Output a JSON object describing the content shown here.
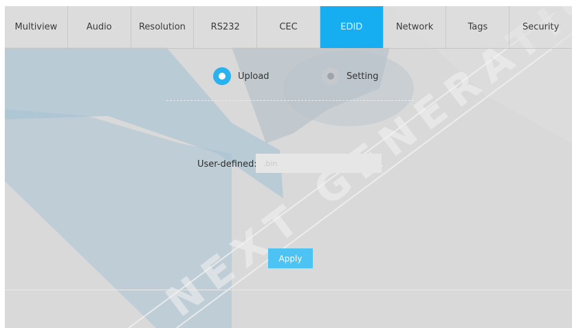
{
  "tabs": [
    {
      "label": "Multiview",
      "active": false
    },
    {
      "label": "Audio",
      "active": false
    },
    {
      "label": "Resolution",
      "active": false
    },
    {
      "label": "RS232",
      "active": false
    },
    {
      "label": "CEC",
      "active": false
    },
    {
      "label": "EDID",
      "active": true
    },
    {
      "label": "Network",
      "active": false
    },
    {
      "label": "Tags",
      "active": false
    },
    {
      "label": "Security",
      "active": false
    }
  ],
  "edid": {
    "mode_options": [
      {
        "label": "Upload",
        "selected": true
      },
      {
        "label": "Setting",
        "selected": false
      }
    ],
    "user_defined_label": "User-defined:",
    "file_placeholder": ".bin",
    "apply_label": "Apply"
  },
  "watermark_text": "NEXT GENERATION TECH",
  "colors": {
    "accent": "#16aef0",
    "apply": "#4cc3f2",
    "background": "#d9d9d9"
  }
}
